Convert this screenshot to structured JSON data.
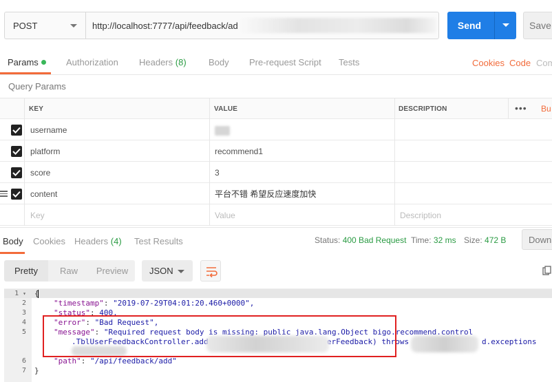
{
  "request": {
    "method": "POST",
    "url": "http://localhost:7777/api/feedback/ad",
    "send_label": "Send",
    "save_label": "Save"
  },
  "request_tabs": [
    {
      "label": "Params",
      "active": true
    },
    {
      "label": "Authorization"
    },
    {
      "label": "Headers",
      "count": "(8)"
    },
    {
      "label": "Body"
    },
    {
      "label": "Pre-request Script"
    },
    {
      "label": "Tests"
    }
  ],
  "links": {
    "cookies": "Cookies",
    "code": "Code",
    "comments": "Com"
  },
  "query_params": {
    "title": "Query Params",
    "headers": {
      "key": "KEY",
      "value": "VALUE",
      "description": "DESCRIPTION",
      "more": "•••",
      "bulk": "Bu"
    },
    "rows": [
      {
        "key": "username",
        "value": "",
        "checked": true
      },
      {
        "key": "platform",
        "value": "recommend1",
        "checked": true
      },
      {
        "key": "score",
        "value": "3",
        "checked": true
      },
      {
        "key": "content",
        "value": "平台不错 希望反应速度加快",
        "checked": true
      }
    ],
    "placeholders": {
      "key": "Key",
      "value": "Value",
      "description": "Description"
    }
  },
  "response_tabs": [
    {
      "label": "Body",
      "active": true
    },
    {
      "label": "Cookies"
    },
    {
      "label": "Headers",
      "count": "(4)"
    },
    {
      "label": "Test Results"
    }
  ],
  "response_status": {
    "status_label": "Status:",
    "status_value": "400 Bad Request",
    "time_label": "Time:",
    "time_value": "32 ms",
    "size_label": "Size:",
    "size_value": "472 B",
    "download_label": "Downl"
  },
  "response_toolbar": {
    "views": [
      "Pretty",
      "Raw",
      "Preview"
    ],
    "format": "JSON"
  },
  "response_body": {
    "line_numbers": [
      "1",
      "2",
      "3",
      "4",
      "5",
      "",
      "6",
      "7"
    ],
    "lines": [
      {
        "k": "",
        "v": "{"
      },
      {
        "k": "\"timestamp\"",
        "v": "\"2019-07-29T04:01:20.460+0000\","
      },
      {
        "k": "\"status\"",
        "v": "400,"
      },
      {
        "k": "\"error\"",
        "v": "\"Bad Request\","
      },
      {
        "k": "\"message\"",
        "v": "\"Required request body is missing: public java.lang.Object bigo.recommend.control"
      },
      {
        "k": "",
        "v": ".TblUserFeedbackController.add                          erFeedback) throws                d.exceptions"
      },
      {
        "k": "\"path\"",
        "v": "\"/api/feedback/add\""
      },
      {
        "k": "",
        "v": "}"
      }
    ]
  },
  "colors": {
    "accent": "#f26b3a",
    "send": "#1f7ee6",
    "status_ok": "#2a9b43",
    "highlight_box": "#e02020"
  }
}
